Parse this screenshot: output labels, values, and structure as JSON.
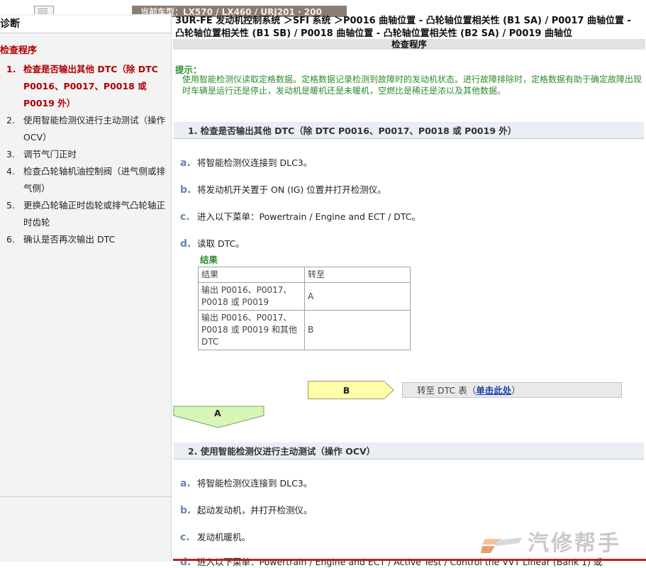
{
  "top": {
    "tab_text": "当前车型：LX570 / LX460 / URJ201 · 200"
  },
  "sidebar": {
    "title": "诊断",
    "subtitle": "检查程序",
    "items": [
      {
        "num": "1.",
        "label": "检查是否输出其他 DTC（除 DTC P0016、P0017、P0018 或 P0019 外）"
      },
      {
        "num": "2.",
        "label": "使用智能检测仪进行主动测试（操作 OCV）"
      },
      {
        "num": "3.",
        "label": "调节气门正时"
      },
      {
        "num": "4.",
        "label": "检查凸轮轴机油控制阀（进气侧或排气侧）"
      },
      {
        "num": "5.",
        "label": "更换凸轮轴正时齿轮或排气凸轮轴正时齿轮"
      },
      {
        "num": "6.",
        "label": "确认是否再次输出 DTC"
      }
    ]
  },
  "main": {
    "breadcrumb": "3UR-FE 发动机控制系统 ＞SFI 系统 ＞P0016 曲轴位置 - 凸轮轴位置相关性 (B1 SA) / P0017 曲轴位置 - 凸轮轴位置相关性 (B1 SB) / P0018 曲轴位置 - 凸轮轴位置相关性 (B2 SA) / P0019 曲轴位",
    "procedure_title": "检查程序",
    "hint_label": "提示：",
    "hint_text": "使用智能检测仪读取定格数据。定格数据记录检测到故障时的发动机状态。进行故障排除时，定格数据有助于确定故障出现时车辆是运行还是停止，发动机是暖机还是未暖机，空燃比是稀还是浓以及其他数据。",
    "section1": {
      "title": "1. 检查是否输出其他 DTC（除 DTC P0016、P0017、P0018 或 P0019 外）",
      "steps": [
        {
          "letter": "a.",
          "text": "将智能检测仪连接到 DLC3。"
        },
        {
          "letter": "b.",
          "text": "将发动机开关置于 ON (IG) 位置并打开检测仪。"
        },
        {
          "letter": "c.",
          "text": "进入以下菜单：Powertrain / Engine and ECT / DTC。"
        },
        {
          "letter": "d.",
          "text": "读取 DTC。"
        }
      ],
      "result_label": "结果",
      "table": {
        "headers": [
          "结果",
          "转至"
        ],
        "rows": [
          [
            "输出 P0016、P0017、P0018 或 P0019",
            "A"
          ],
          [
            "输出 P0016、P0017、P0018 或 P0019 和其他 DTC",
            "B"
          ]
        ]
      },
      "b_label": "B",
      "goto_prefix": "转至 DTC 表（",
      "goto_link": "单击此处",
      "goto_suffix": "）",
      "a_label": "A"
    },
    "section2": {
      "title": "2. 使用智能检测仪进行主动测试（操作 OCV）",
      "steps": [
        {
          "letter": "a.",
          "text": "将智能检测仪连接到 DLC3。"
        },
        {
          "letter": "b.",
          "text": "起动发动机，并打开检测仪。"
        },
        {
          "letter": "c.",
          "text": "发动机暖机。"
        },
        {
          "letter": "d.",
          "text": "进入以下菜单：Powertrain / Engine and ECT / Active Test / Control the VVT Linear (Bank 1) 或"
        }
      ]
    }
  },
  "watermark": {
    "text": "汽修帮手"
  },
  "colors": {
    "accent_red": "#b00000",
    "hint_green": "#2e8b2e",
    "link_blue": "#1a3fa8",
    "b_box_fill": "#ffffa8",
    "a_arrow_fill": "#d8f5b8"
  }
}
